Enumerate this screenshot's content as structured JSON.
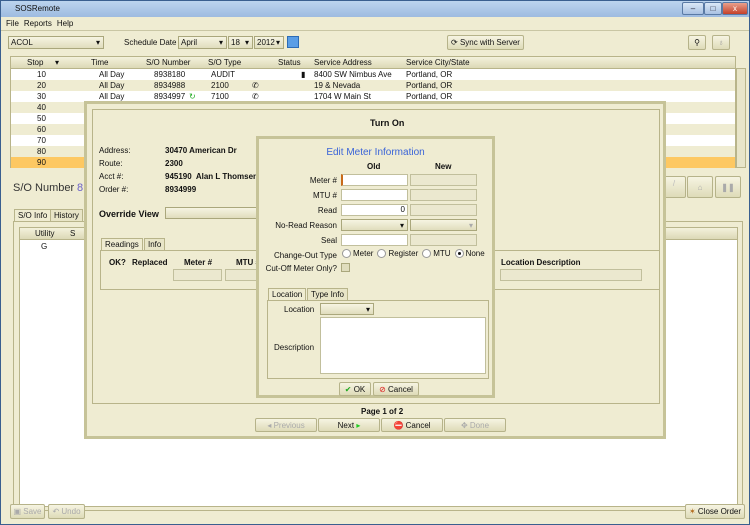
{
  "window": {
    "title": "SOSRemote",
    "min": "–",
    "max": "□",
    "close": "x"
  },
  "menu": [
    "File",
    "Reports",
    "Help"
  ],
  "toolbar": {
    "route": "ACOL",
    "schedule_label": "Schedule Date",
    "month": "April",
    "day": "18",
    "year": "2012",
    "sync_label": "Sync with Server"
  },
  "grid": {
    "columns": [
      "Stop",
      "Time",
      "S/O Number",
      "S/O Type",
      "",
      "Status",
      "Service Address",
      "Service City/State"
    ],
    "rows": [
      {
        "stop": "10",
        "time": "All Day",
        "so": "8938180",
        "type": "AUDIT",
        "icon": "",
        "status": "lock",
        "addr": "8400 SW Nimbus Ave",
        "city": "Portland, OR"
      },
      {
        "stop": "20",
        "time": "All Day",
        "so": "8934988",
        "type": "2100",
        "icon": "phone",
        "status": "",
        "addr": "19 & Nevada",
        "city": "Portland, OR"
      },
      {
        "stop": "30",
        "time": "All Day",
        "so": "8934997",
        "type": "7100",
        "icon": "phone",
        "status": "",
        "addr": "1704 W Main St",
        "city": "Portland, OR"
      },
      {
        "stop": "40"
      },
      {
        "stop": "50"
      },
      {
        "stop": "60"
      },
      {
        "stop": "70"
      },
      {
        "stop": "80"
      },
      {
        "stop": "90"
      }
    ]
  },
  "main": {
    "so_label": "S/O Number",
    "so_value": "8",
    "tabs": [
      "S/O Info",
      "History"
    ],
    "utility_header": "Utility",
    "se_header": "S",
    "utility_value": "G",
    "save": "Save",
    "undo": "Undo",
    "close_order": "Close Order"
  },
  "turn_on": {
    "title": "Turn On",
    "address_label": "Address:",
    "address": "30470 American Dr",
    "route_label": "Route:",
    "route": "2300",
    "acct_label": "Acct #:",
    "acct": "945190  Alan L Thomsen",
    "order_label": "Order #:",
    "order": "8934999",
    "override_label": "Override View",
    "tabs": [
      "Readings",
      "Info"
    ],
    "cols": [
      "OK?",
      "Replaced",
      "Meter #",
      "MTU #",
      "Location Description"
    ],
    "page": "Page 1 of 2",
    "previous": "Previous",
    "next": "Next",
    "cancel": "Cancel",
    "done": "Done"
  },
  "edit_meter": {
    "title": "Edit Meter Information",
    "old": "Old",
    "new": "New",
    "meter_label": "Meter #",
    "mtu_label": "MTU #",
    "read_label": "Read",
    "read_value": "0",
    "noread_label": "No-Read Reason",
    "seal_label": "Seal",
    "changeout_label": "Change-Out Type",
    "options": [
      "Meter",
      "Register",
      "MTU",
      "None"
    ],
    "selected": "None",
    "cutoff_label": "Cut-Off Meter Only?",
    "tabs": [
      "Location",
      "Type Info"
    ],
    "location_label": "Location",
    "description_label": "Description",
    "ok": "OK",
    "cancel": "Cancel",
    "title_color": "#3a64d8"
  },
  "colors": {
    "selected_row": "#fdc862",
    "background": "#efecd2"
  }
}
